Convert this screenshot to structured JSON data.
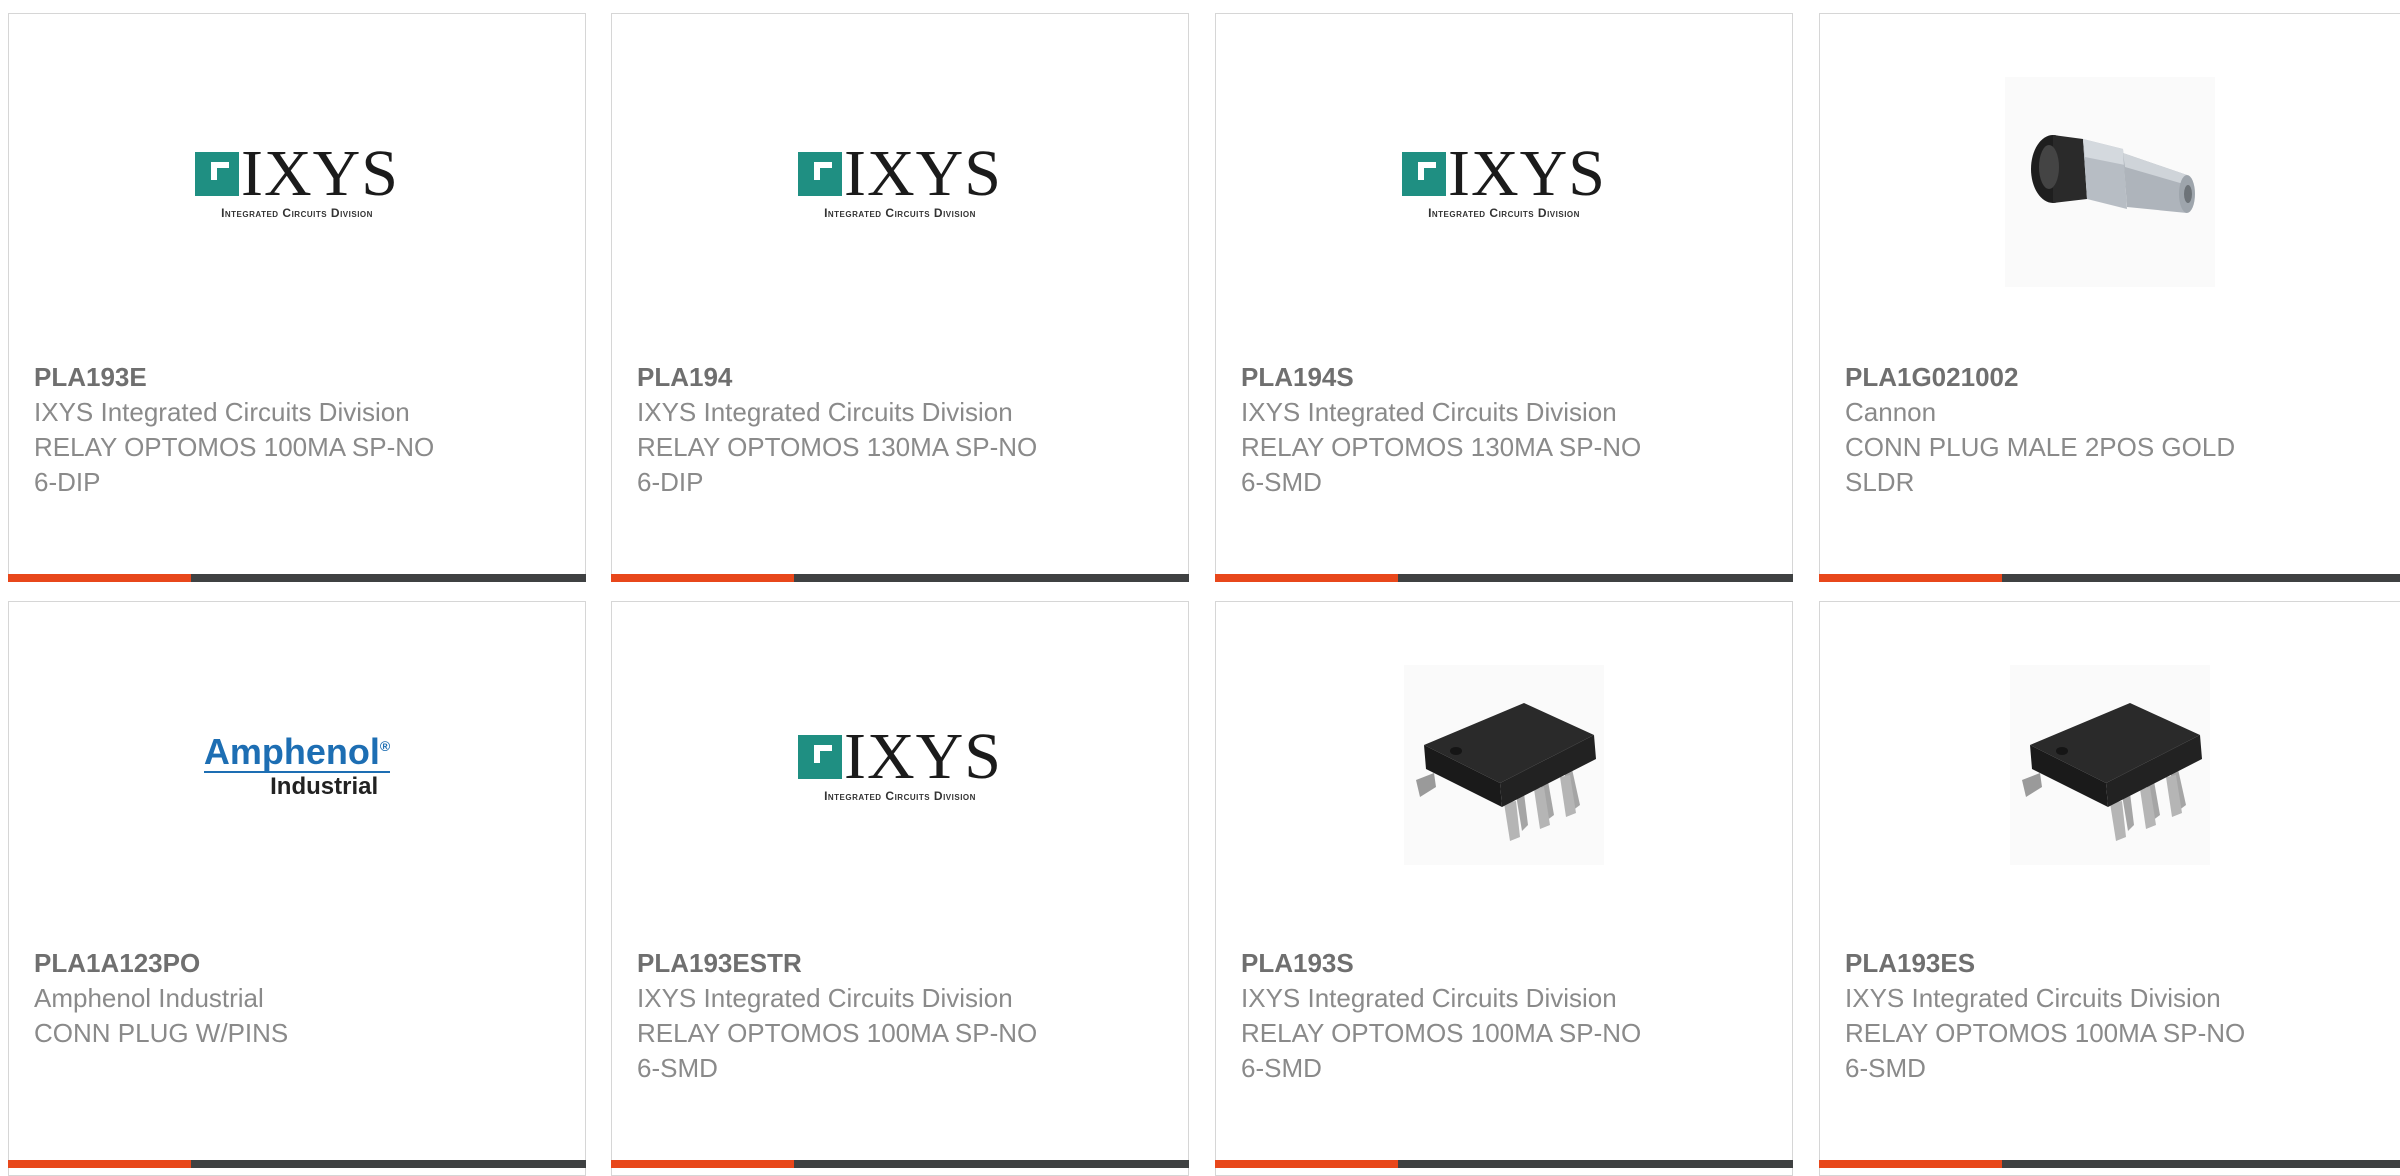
{
  "accent_color": "#e8471b",
  "bar_color": "#3f4142",
  "products": [
    {
      "part_number": "PLA193E",
      "manufacturer": "IXYS Integrated Circuits Division",
      "description": "RELAY OPTOMOS 100MA SP-NO 6-DIP",
      "image": "ixys-logo"
    },
    {
      "part_number": "PLA194",
      "manufacturer": "IXYS Integrated Circuits Division",
      "description": "RELAY OPTOMOS 130MA SP-NO 6-DIP",
      "image": "ixys-logo"
    },
    {
      "part_number": "PLA194S",
      "manufacturer": "IXYS Integrated Circuits Division",
      "description": "RELAY OPTOMOS 130MA SP-NO 6-SMD",
      "image": "ixys-logo"
    },
    {
      "part_number": "PLA1G021002",
      "manufacturer": "Cannon",
      "description": "CONN PLUG MALE 2POS GOLD SLDR",
      "image": "connector-plug-photo"
    },
    {
      "part_number": "PLA1A123PO",
      "manufacturer": "Amphenol Industrial",
      "description": "CONN PLUG W/PINS",
      "image": "amphenol-logo"
    },
    {
      "part_number": "PLA193ESTR",
      "manufacturer": "IXYS Integrated Circuits Division",
      "description": "RELAY OPTOMOS 100MA SP-NO 6-SMD",
      "image": "ixys-logo"
    },
    {
      "part_number": "PLA193S",
      "manufacturer": "IXYS Integrated Circuits Division",
      "description": "RELAY OPTOMOS 100MA SP-NO 6-SMD",
      "image": "smd-chip-photo"
    },
    {
      "part_number": "PLA193ES",
      "manufacturer": "IXYS Integrated Circuits Division",
      "description": "RELAY OPTOMOS 100MA SP-NO 6-SMD",
      "image": "smd-chip-photo"
    }
  ],
  "logos": {
    "ixys_word": "IXYS",
    "ixys_sub": "Integrated Circuits Division",
    "amphenol_word": "Amphenol",
    "amphenol_reg": "®",
    "amphenol_sub": "Industrial"
  }
}
